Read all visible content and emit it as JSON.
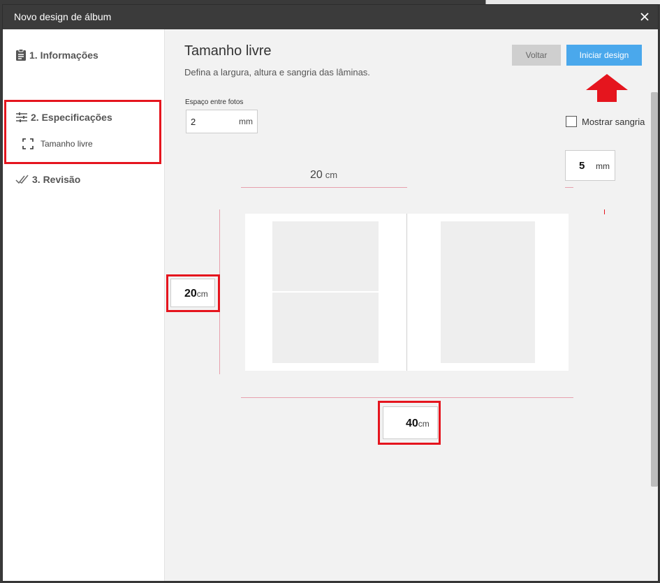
{
  "window": {
    "title": "Novo design de álbum"
  },
  "sidebar": {
    "steps": [
      {
        "label": "1. Informações"
      },
      {
        "label": "2. Especificações"
      },
      {
        "label": "3. Revisão"
      }
    ],
    "substep": {
      "label": "Tamanho livre"
    }
  },
  "main": {
    "title": "Tamanho livre",
    "description": "Defina a largura, altura e sangria das lâminas.",
    "buttons": {
      "back": "Voltar",
      "start": "Iniciar design"
    },
    "spacing": {
      "label": "Espaço entre fotos",
      "value": "2",
      "unit": "mm"
    },
    "bleed": {
      "checkbox_label": "Mostrar sangria",
      "value": "5",
      "unit": "mm"
    },
    "page_width": {
      "value": "20",
      "unit": "cm"
    },
    "height": {
      "value": "20",
      "unit": "cm"
    },
    "width": {
      "value": "40",
      "unit": "cm"
    }
  },
  "colors": {
    "accent": "#4aa8ec",
    "highlight": "#e5151e",
    "guide": "#e7a0ad",
    "titlebar": "#3b3b3b"
  },
  "icons": [
    "clipboard-icon",
    "sliders-icon",
    "resize-frame-icon",
    "double-check-icon",
    "close-icon",
    "up-arrow-icon"
  ]
}
